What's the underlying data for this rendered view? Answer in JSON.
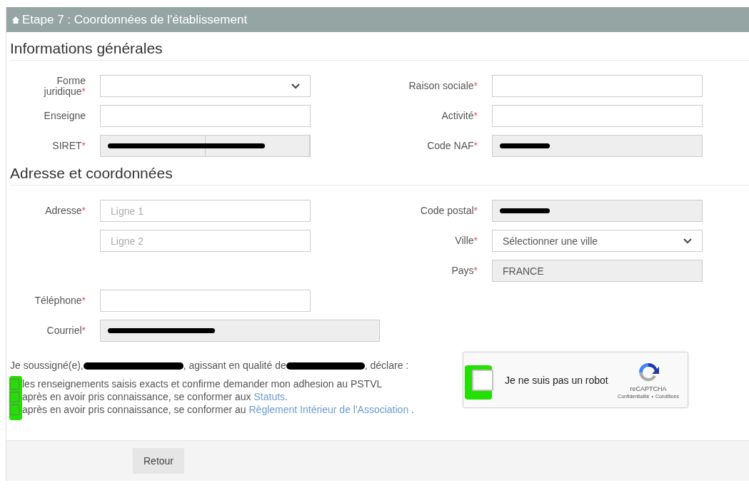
{
  "header": {
    "title": "Etape 7 : Coordonnées de l'établissement"
  },
  "sections": [
    {
      "title": "Informations générales",
      "left": [
        {
          "kind": "select",
          "label": "Forme juridique",
          "required_mark": "*"
        },
        {
          "kind": "text",
          "label": "Enseigne"
        },
        {
          "kind": "split",
          "label": "SIRET",
          "required_mark": "*",
          "redacted": true
        }
      ],
      "right": [
        {
          "kind": "text",
          "label": "Raison sociale",
          "required_mark": "*"
        },
        {
          "kind": "text",
          "label": "Activité",
          "required_mark": "*"
        },
        {
          "kind": "readonly",
          "label": "Code NAF",
          "required_mark": "*",
          "redacted": true
        }
      ]
    },
    {
      "title": "Adresse et coordonnées",
      "left": [
        {
          "kind": "text",
          "label": "Adresse",
          "required_mark": "*",
          "placeholder": "Ligne 1"
        },
        {
          "kind": "text",
          "placeholder": "Ligne 2"
        },
        {
          "kind": "spacer"
        },
        {
          "kind": "text",
          "label": "Téléphone",
          "required_mark": "*"
        }
      ],
      "right": [
        {
          "kind": "readonly",
          "label": "Code postal",
          "required_mark": "*",
          "redacted": true
        },
        {
          "kind": "select",
          "label": "Ville",
          "required_mark": "*",
          "value": "Sélectionner une ville"
        },
        {
          "kind": "readonly",
          "label": "Pays",
          "required_mark": "*",
          "value": "FRANCE"
        }
      ],
      "wide": [
        {
          "kind": "readonly",
          "label": "Courriel",
          "required_mark": "*",
          "redacted": true
        }
      ]
    }
  ],
  "declaration": {
    "parts": [
      {
        "kind": "text",
        "text": "Je soussigné(e),"
      },
      {
        "kind": "redacted"
      },
      {
        "kind": "text",
        "text": ", agissant en qualité de"
      },
      {
        "kind": "redacted"
      },
      {
        "kind": "text",
        "text": ", déclare :"
      }
    ],
    "items": [
      {
        "checked": false,
        "text": "les renseignements saisis exacts et confirme demander mon adhesion au PSTVL"
      },
      {
        "checked": false,
        "text": "après en avoir pris connaissance, se conformer aux ",
        "link": "Statuts",
        "after": "."
      },
      {
        "checked": false,
        "text": "après en avoir pris connaissance, se conformer au ",
        "link": "Règlement Intérieur de l'Association",
        "after": " ."
      }
    ]
  },
  "captcha": {
    "checked": false,
    "label": "Je ne suis pas un robot",
    "brand": "reCAPTCHA",
    "privacy": "Confidentialité",
    "separator": "•",
    "terms": "Conditions"
  },
  "buttons": [
    "Retour"
  ]
}
